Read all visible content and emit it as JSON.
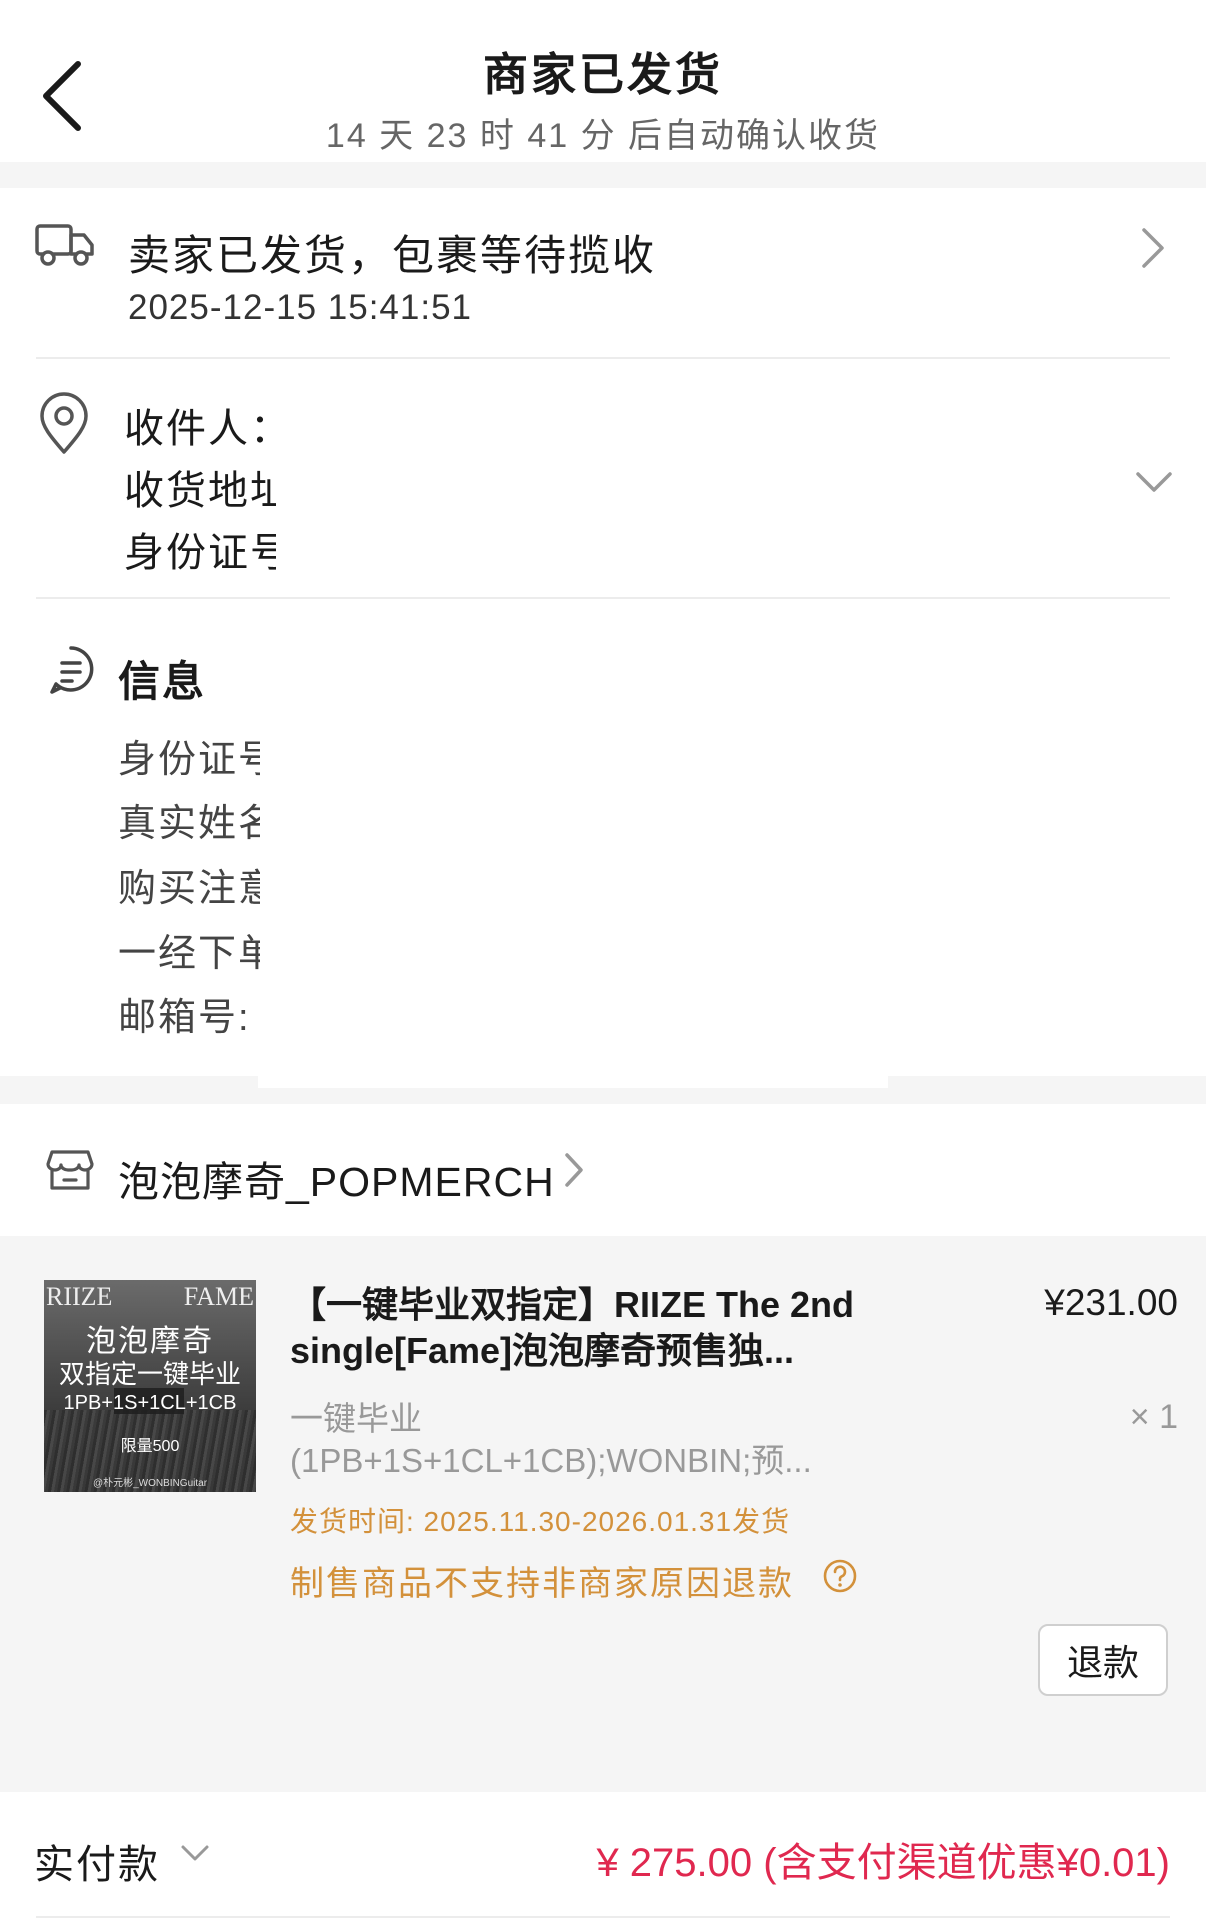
{
  "header": {
    "title": "商家已发货",
    "subtitle": "14 天 23 时 41 分  后自动确认收货"
  },
  "shipment": {
    "icon": "truck-icon",
    "status": "卖家已发货，包裹等待揽收",
    "time": "2025-12-15 15:41:51"
  },
  "address": {
    "icon": "location-pin-icon",
    "recipient_label": "收件人：",
    "address_label": "收货地址",
    "id_label": "身份证号"
  },
  "info": {
    "icon": "memo-icon",
    "title": "信息",
    "lines": [
      "身份证号",
      "真实姓名",
      "购买注意",
      "一经下单",
      "邮箱号:"
    ]
  },
  "shop": {
    "icon": "store-icon",
    "name": "泡泡摩奇_POPMERCH"
  },
  "product": {
    "thumb": {
      "brand_left": "RIIZE",
      "brand_right": "FAME",
      "line1": "泡泡摩奇",
      "line2": "双指定一键毕业",
      "spec": "1PB+1S+1CL+1CB",
      "limit": "限量500",
      "credit": "@朴元彬_WONBINGuitar"
    },
    "title": "【一键毕业双指定】RIIZE The 2nd single[Fame]泡泡摩奇预售独...",
    "price": "¥231.00",
    "variant": "一键毕业(1PB+1S+1CL+1CB);WONBIN;预...",
    "quantity": "× 1",
    "ship_time": "发货时间: 2025.11.30-2026.01.31发货",
    "policy": "制售商品不支持非商家原因退款",
    "refund_button": "退款"
  },
  "payment": {
    "label": "实付款",
    "value": "¥ 275.00 (含支付渠道优惠¥0.01)"
  },
  "colors": {
    "accent_orange": "#d3913b",
    "price_red": "#e0284f",
    "section_gap": "#f5f5f5"
  }
}
